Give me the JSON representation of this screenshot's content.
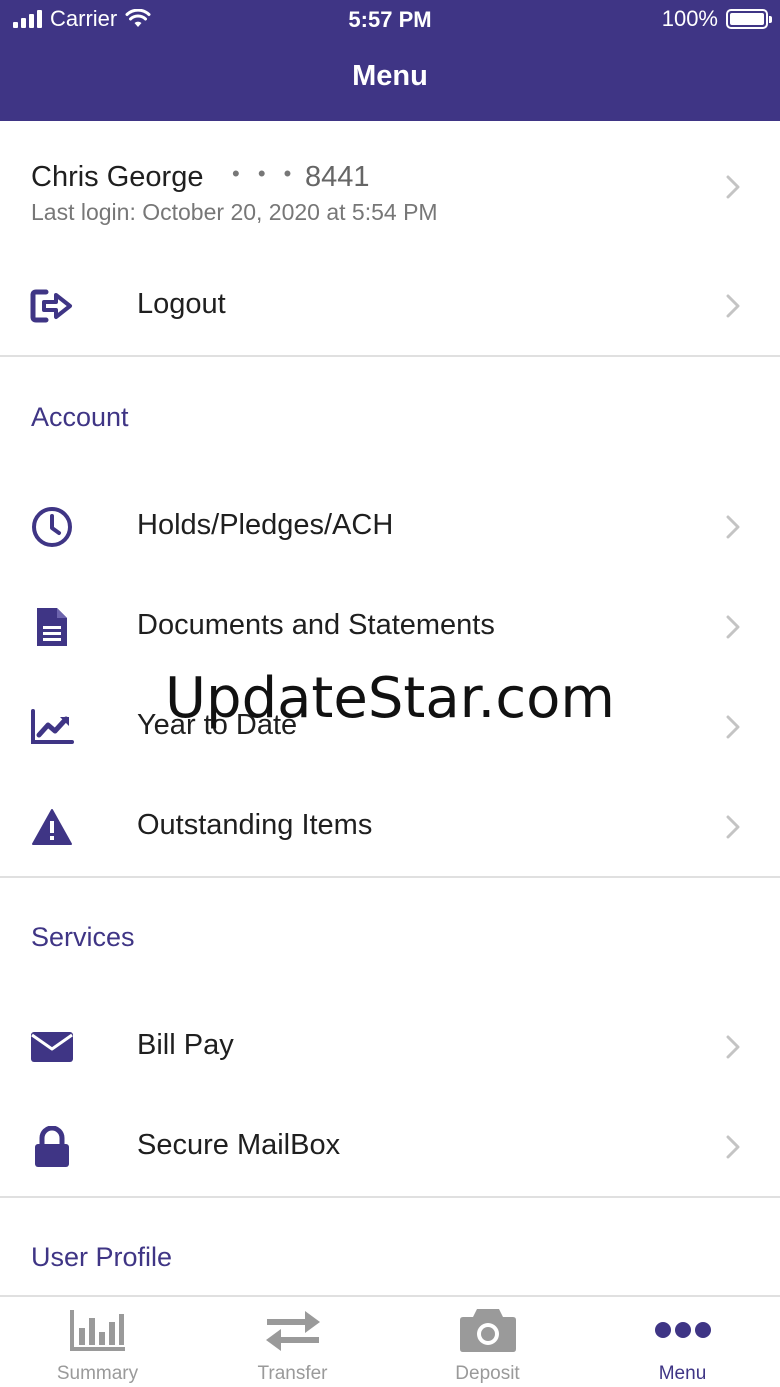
{
  "status_bar": {
    "carrier": "Carrier",
    "time": "5:57 PM",
    "battery": "100%"
  },
  "header": {
    "title": "Menu"
  },
  "profile": {
    "name": "Chris George",
    "account_mask": "• • •",
    "account_suffix": "8441",
    "last_login": "Last login: October 20, 2020 at 5:54 PM"
  },
  "logout": {
    "label": "Logout",
    "icon": "logout-icon"
  },
  "sections": {
    "account": {
      "title": "Account",
      "items": [
        {
          "label": "Holds/Pledges/ACH",
          "icon": "clock-icon"
        },
        {
          "label": "Documents and Statements",
          "icon": "document-icon"
        },
        {
          "label": "Year to Date",
          "icon": "chart-line-icon"
        },
        {
          "label": "Outstanding Items",
          "icon": "warning-icon"
        }
      ]
    },
    "services": {
      "title": "Services",
      "items": [
        {
          "label": "Bill Pay",
          "icon": "envelope-icon"
        },
        {
          "label": "Secure MailBox",
          "icon": "lock-icon"
        }
      ]
    },
    "user_profile": {
      "title": "User Profile"
    }
  },
  "watermark": "UpdateStar.com",
  "tabs": [
    {
      "label": "Summary",
      "icon": "bar-chart-icon",
      "active": false
    },
    {
      "label": "Transfer",
      "icon": "transfer-arrows-icon",
      "active": false
    },
    {
      "label": "Deposit",
      "icon": "camera-icon",
      "active": false
    },
    {
      "label": "Menu",
      "icon": "more-dots-icon",
      "active": true
    }
  ],
  "colors": {
    "brand": "#3f3585",
    "inactive": "#9a9a9a",
    "divider": "#e0e0e0",
    "chevron": "#c4c4c4"
  }
}
